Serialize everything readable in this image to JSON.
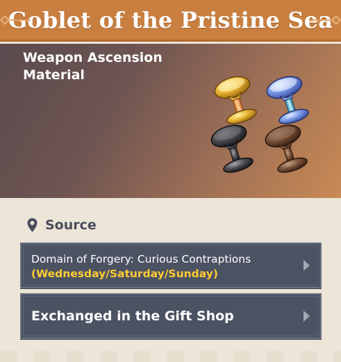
{
  "item": {
    "name": "Goblet of the Pristine Sea",
    "type": "Weapon Ascension Material"
  },
  "source": {
    "heading": "Source",
    "entries": [
      {
        "label": "Domain of Forgery: Curious Contraptions",
        "detail": "(Wednesday/Saturday/Sunday)"
      },
      {
        "label": "Exchanged in the Gift Shop"
      }
    ]
  },
  "icons": {
    "location": "map-pin-icon",
    "arrow": "chevron-right-icon"
  },
  "colors": {
    "title_bar": "#c87f3f",
    "button_bg": "#4b5262",
    "highlight_text": "#ffcc33",
    "panel_bg": "#ece5d8"
  }
}
